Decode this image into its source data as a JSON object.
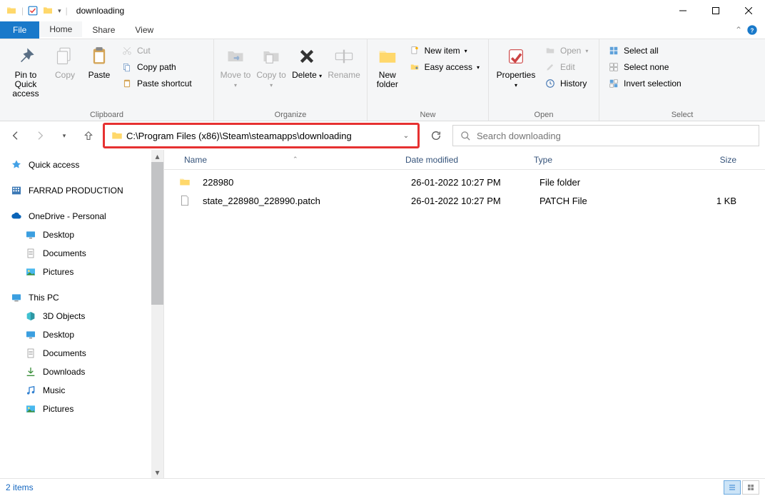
{
  "title": "downloading",
  "menubar": {
    "file": "File",
    "home": "Home",
    "share": "Share",
    "view": "View"
  },
  "ribbon": {
    "clipboard": {
      "label": "Clipboard",
      "pin": "Pin to Quick access",
      "copy": "Copy",
      "paste": "Paste",
      "cut": "Cut",
      "copypath": "Copy path",
      "pasteshortcut": "Paste shortcut"
    },
    "organize": {
      "label": "Organize",
      "moveto": "Move to",
      "copyto": "Copy to",
      "delete": "Delete",
      "rename": "Rename"
    },
    "new": {
      "label": "New",
      "newfolder": "New folder",
      "newitem": "New item",
      "easyaccess": "Easy access"
    },
    "open": {
      "label": "Open",
      "properties": "Properties",
      "open": "Open",
      "edit": "Edit",
      "history": "History"
    },
    "select": {
      "label": "Select",
      "selectall": "Select all",
      "selectnone": "Select none",
      "invert": "Invert selection"
    }
  },
  "address": "C:\\Program Files (x86)\\Steam\\steamapps\\downloading",
  "search_placeholder": "Search downloading",
  "columns": {
    "name": "Name",
    "date": "Date modified",
    "type": "Type",
    "size": "Size"
  },
  "sidebar": {
    "quick": "Quick access",
    "farrad": "FARRAD PRODUCTION",
    "onedrive": "OneDrive - Personal",
    "od_desktop": "Desktop",
    "od_documents": "Documents",
    "od_pictures": "Pictures",
    "thispc": "This PC",
    "pc_3d": "3D Objects",
    "pc_desktop": "Desktop",
    "pc_documents": "Documents",
    "pc_downloads": "Downloads",
    "pc_music": "Music",
    "pc_pictures": "Pictures"
  },
  "files": [
    {
      "name": "228980",
      "date": "26-01-2022 10:27 PM",
      "type": "File folder",
      "size": ""
    },
    {
      "name": "state_228980_228990.patch",
      "date": "26-01-2022 10:27 PM",
      "type": "PATCH File",
      "size": "1 KB"
    }
  ],
  "status": "2 items"
}
